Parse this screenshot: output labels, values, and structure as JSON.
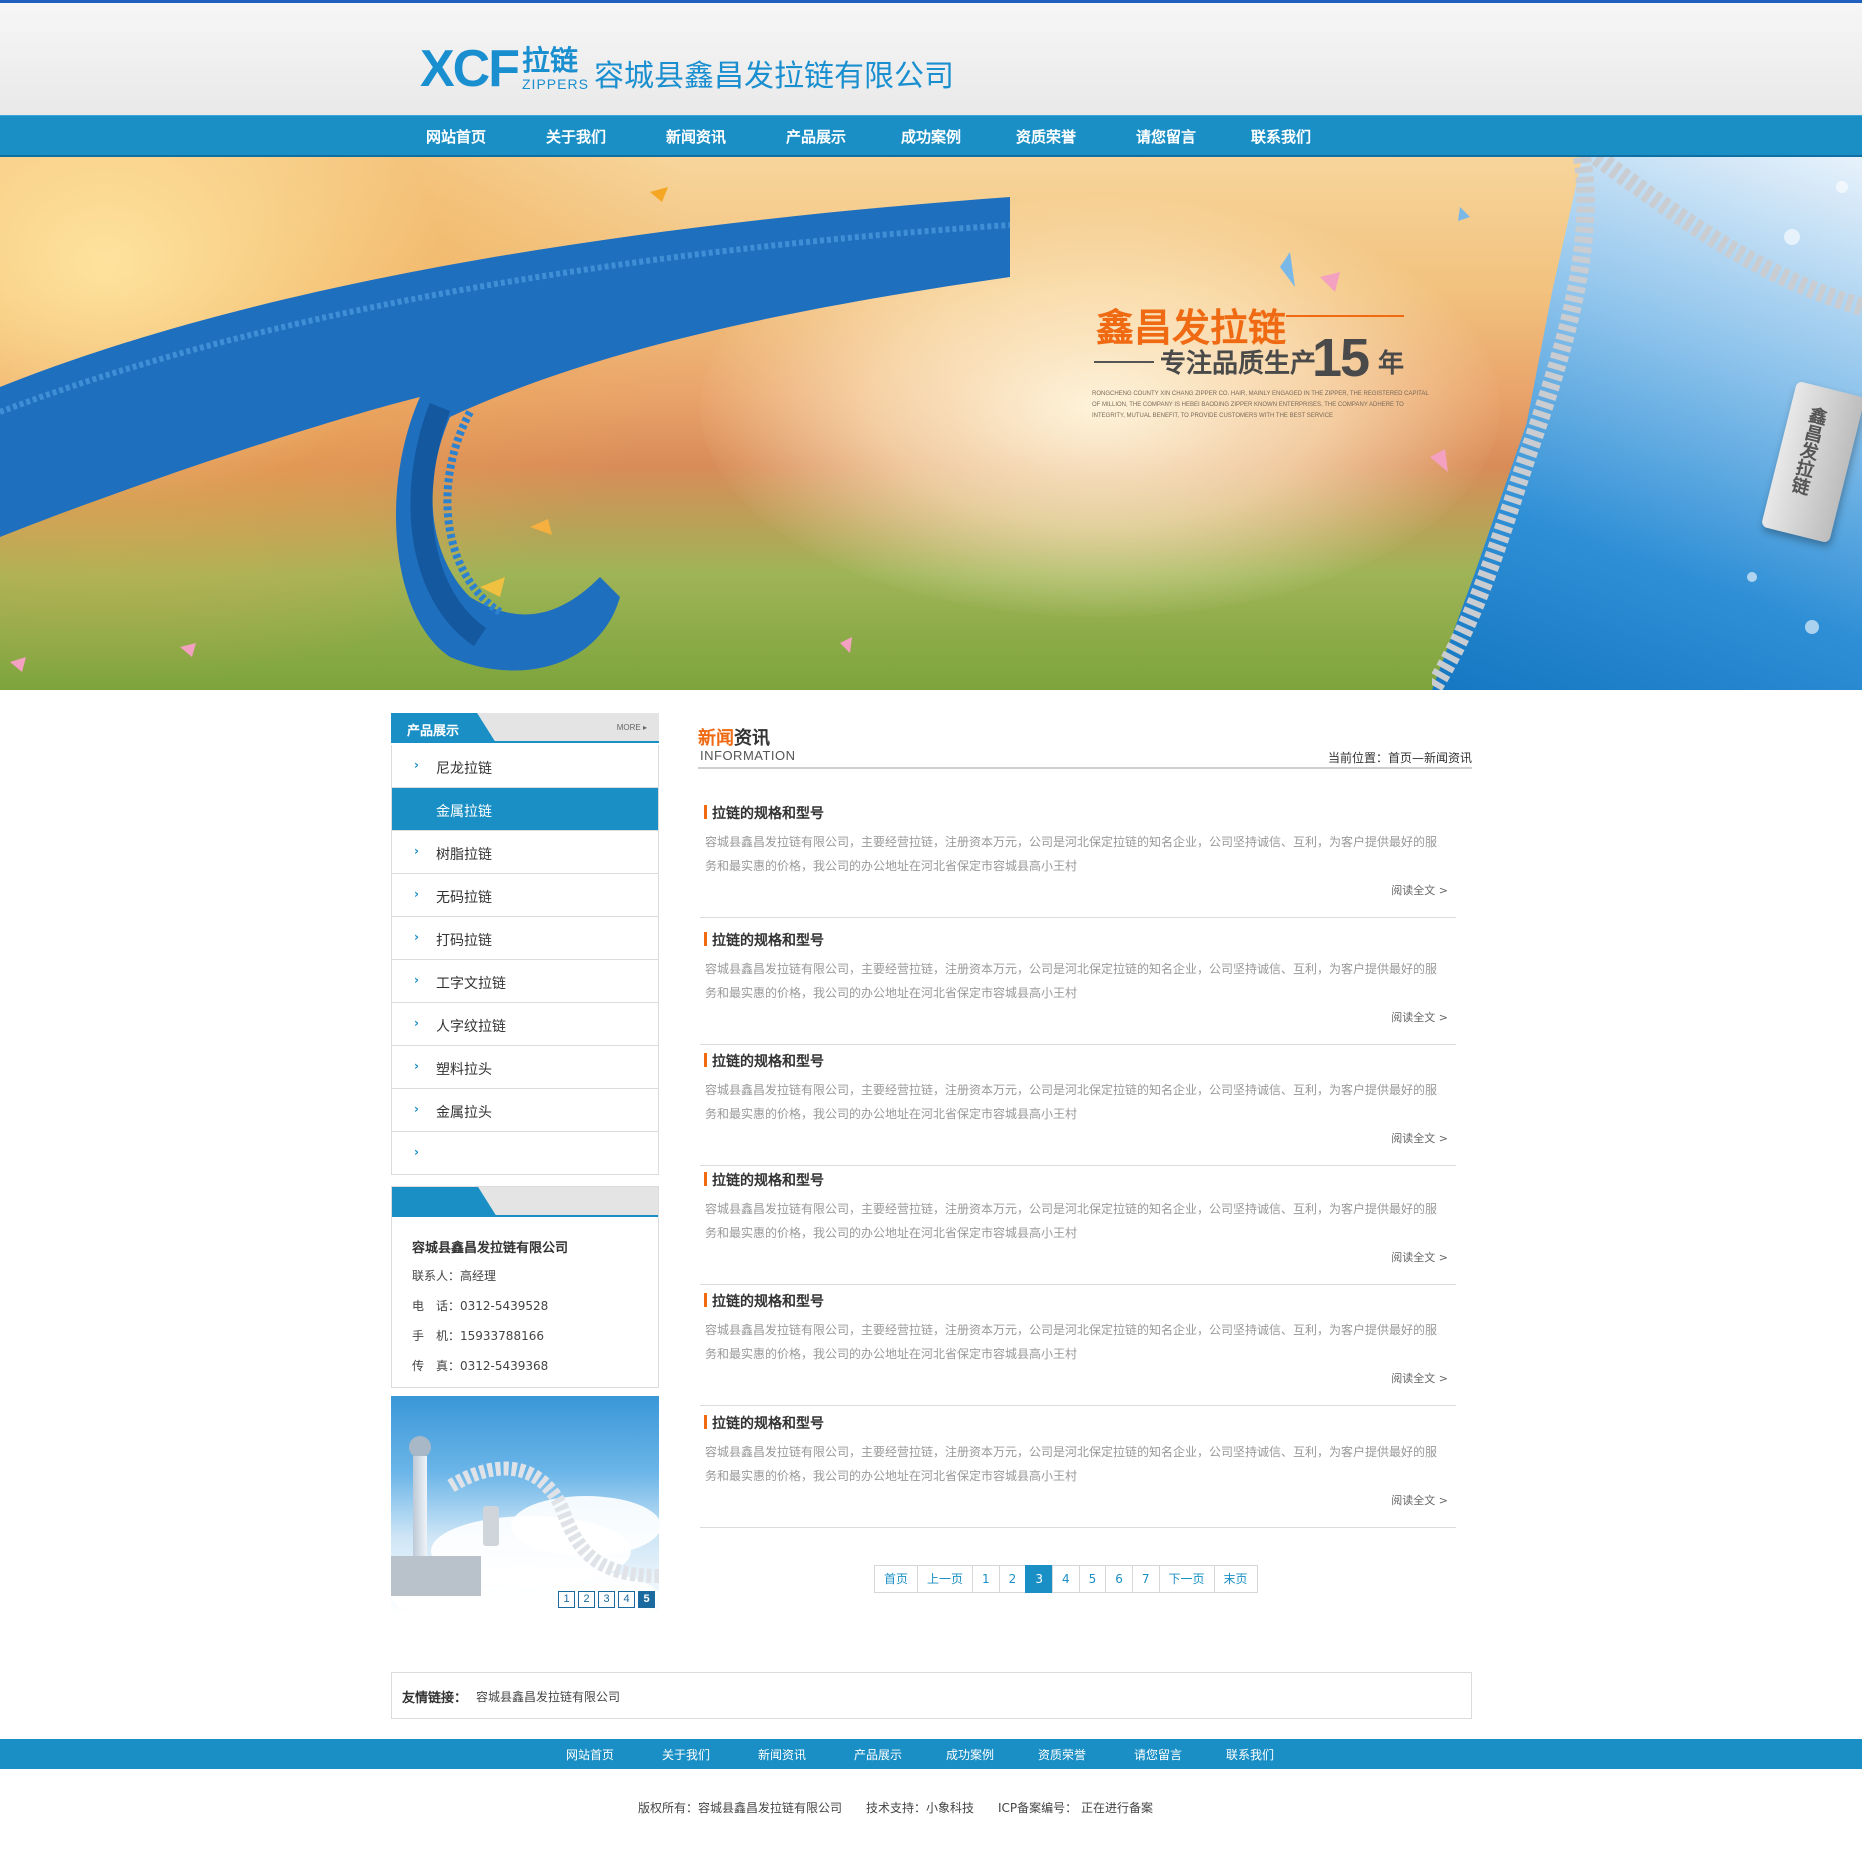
{
  "brand": {
    "logo_main": "XCF",
    "logo_zh": "拉链",
    "logo_en": "ZIPPERS",
    "company_name": "容城县鑫昌发拉链有限公司",
    "accent": "#1a8fc5",
    "highlight": "#ef6a12"
  },
  "nav": {
    "items": [
      {
        "label": "网站首页"
      },
      {
        "label": "关于我们"
      },
      {
        "label": "新闻资讯"
      },
      {
        "label": "产品展示"
      },
      {
        "label": "成功案例"
      },
      {
        "label": "资质荣誉"
      },
      {
        "label": "请您留言"
      },
      {
        "label": "联系我们"
      }
    ]
  },
  "banner": {
    "title": "鑫昌发拉链",
    "subtitle": "专注品质生产",
    "years_number": "15",
    "years_unit": "年",
    "english_text": "RONGCHENG COUNTY XIN CHANG ZIPPER CO. HAIR, MAINLY ENGAGED IN THE ZIPPER, THE REGISTERED CAPITAL OF MILLION, THE COMPANY IS HEBEI BAODING ZIPPER KNOWN ENTERPRISES, THE COMPANY ADHERE TO INTEGRITY, MUTUAL BENEFIT, TO PROVIDE CUSTOMERS WITH THE BEST SERVICE",
    "tag_text": "鑫昌发拉链"
  },
  "sidebar": {
    "products_title": "产品展示",
    "more_label": "MORE ▸",
    "products": [
      {
        "label": "尼龙拉链",
        "active": false
      },
      {
        "label": "金属拉链",
        "active": true
      },
      {
        "label": "树脂拉链",
        "active": false
      },
      {
        "label": "无码拉链",
        "active": false
      },
      {
        "label": "打码拉链",
        "active": false
      },
      {
        "label": "工字文拉链",
        "active": false
      },
      {
        "label": "人字纹拉链",
        "active": false
      },
      {
        "label": "塑料拉头",
        "active": false
      },
      {
        "label": "金属拉头",
        "active": false
      },
      {
        "label": "",
        "active": false
      }
    ],
    "contact": {
      "company": "容城县鑫昌发拉链有限公司",
      "person": "联系人：高经理",
      "phone": "电　话：0312-5439528",
      "mobile": "手　机：15933788166",
      "fax": "传　真：0312-5439368"
    },
    "slides": [
      "1",
      "2",
      "3",
      "4",
      "5"
    ],
    "active_slide": 5
  },
  "main": {
    "title_highlight": "新闻",
    "title_rest": "资讯",
    "title_en": "INFORMATION",
    "breadcrumb": "当前位置：首页—新闻资讯",
    "articles": [
      {
        "title": "拉链的规格和型号",
        "body": "容城县鑫昌发拉链有限公司，主要经营拉链，注册资本万元，公司是河北保定拉链的知名企业，公司坚持诚信、互利，为客户提供最好的服务和最实惠的价格，我公司的办公地址在河北省保定市容城县高小王村",
        "more": "阅读全文 >"
      },
      {
        "title": "拉链的规格和型号",
        "body": "容城县鑫昌发拉链有限公司，主要经营拉链，注册资本万元，公司是河北保定拉链的知名企业，公司坚持诚信、互利，为客户提供最好的服务和最实惠的价格，我公司的办公地址在河北省保定市容城县高小王村",
        "more": "阅读全文 >"
      },
      {
        "title": "拉链的规格和型号",
        "body": "容城县鑫昌发拉链有限公司，主要经营拉链，注册资本万元，公司是河北保定拉链的知名企业，公司坚持诚信、互利，为客户提供最好的服务和最实惠的价格，我公司的办公地址在河北省保定市容城县高小王村",
        "more": "阅读全文 >"
      },
      {
        "title": "拉链的规格和型号",
        "body": "容城县鑫昌发拉链有限公司，主要经营拉链，注册资本万元，公司是河北保定拉链的知名企业，公司坚持诚信、互利，为客户提供最好的服务和最实惠的价格，我公司的办公地址在河北省保定市容城县高小王村",
        "more": "阅读全文 >"
      },
      {
        "title": "拉链的规格和型号",
        "body": "容城县鑫昌发拉链有限公司，主要经营拉链，注册资本万元，公司是河北保定拉链的知名企业，公司坚持诚信、互利，为客户提供最好的服务和最实惠的价格，我公司的办公地址在河北省保定市容城县高小王村",
        "more": "阅读全文 >"
      },
      {
        "title": "拉链的规格和型号",
        "body": "容城县鑫昌发拉链有限公司，主要经营拉链，注册资本万元，公司是河北保定拉链的知名企业，公司坚持诚信、互利，为客户提供最好的服务和最实惠的价格，我公司的办公地址在河北省保定市容城县高小王村",
        "more": "阅读全文 >"
      }
    ]
  },
  "pagination": {
    "first": "首页",
    "prev": "上一页",
    "pages": [
      "1",
      "2",
      "3",
      "4",
      "5",
      "6",
      "7"
    ],
    "current": "3",
    "next": "下一页",
    "last": "末页"
  },
  "friend_links": {
    "label": "友情链接：",
    "items": [
      "容城县鑫昌发拉链有限公司"
    ]
  },
  "footer": {
    "nav": [
      "网站首页",
      "关于我们",
      "新闻资讯",
      "产品展示",
      "成功案例",
      "资质荣誉",
      "请您留言",
      "联系我们"
    ],
    "copyright": "版权所有：容城县鑫昌发拉链有限公司　　技术支持：小象科技　　ICP备案编号： 正在进行备案"
  }
}
